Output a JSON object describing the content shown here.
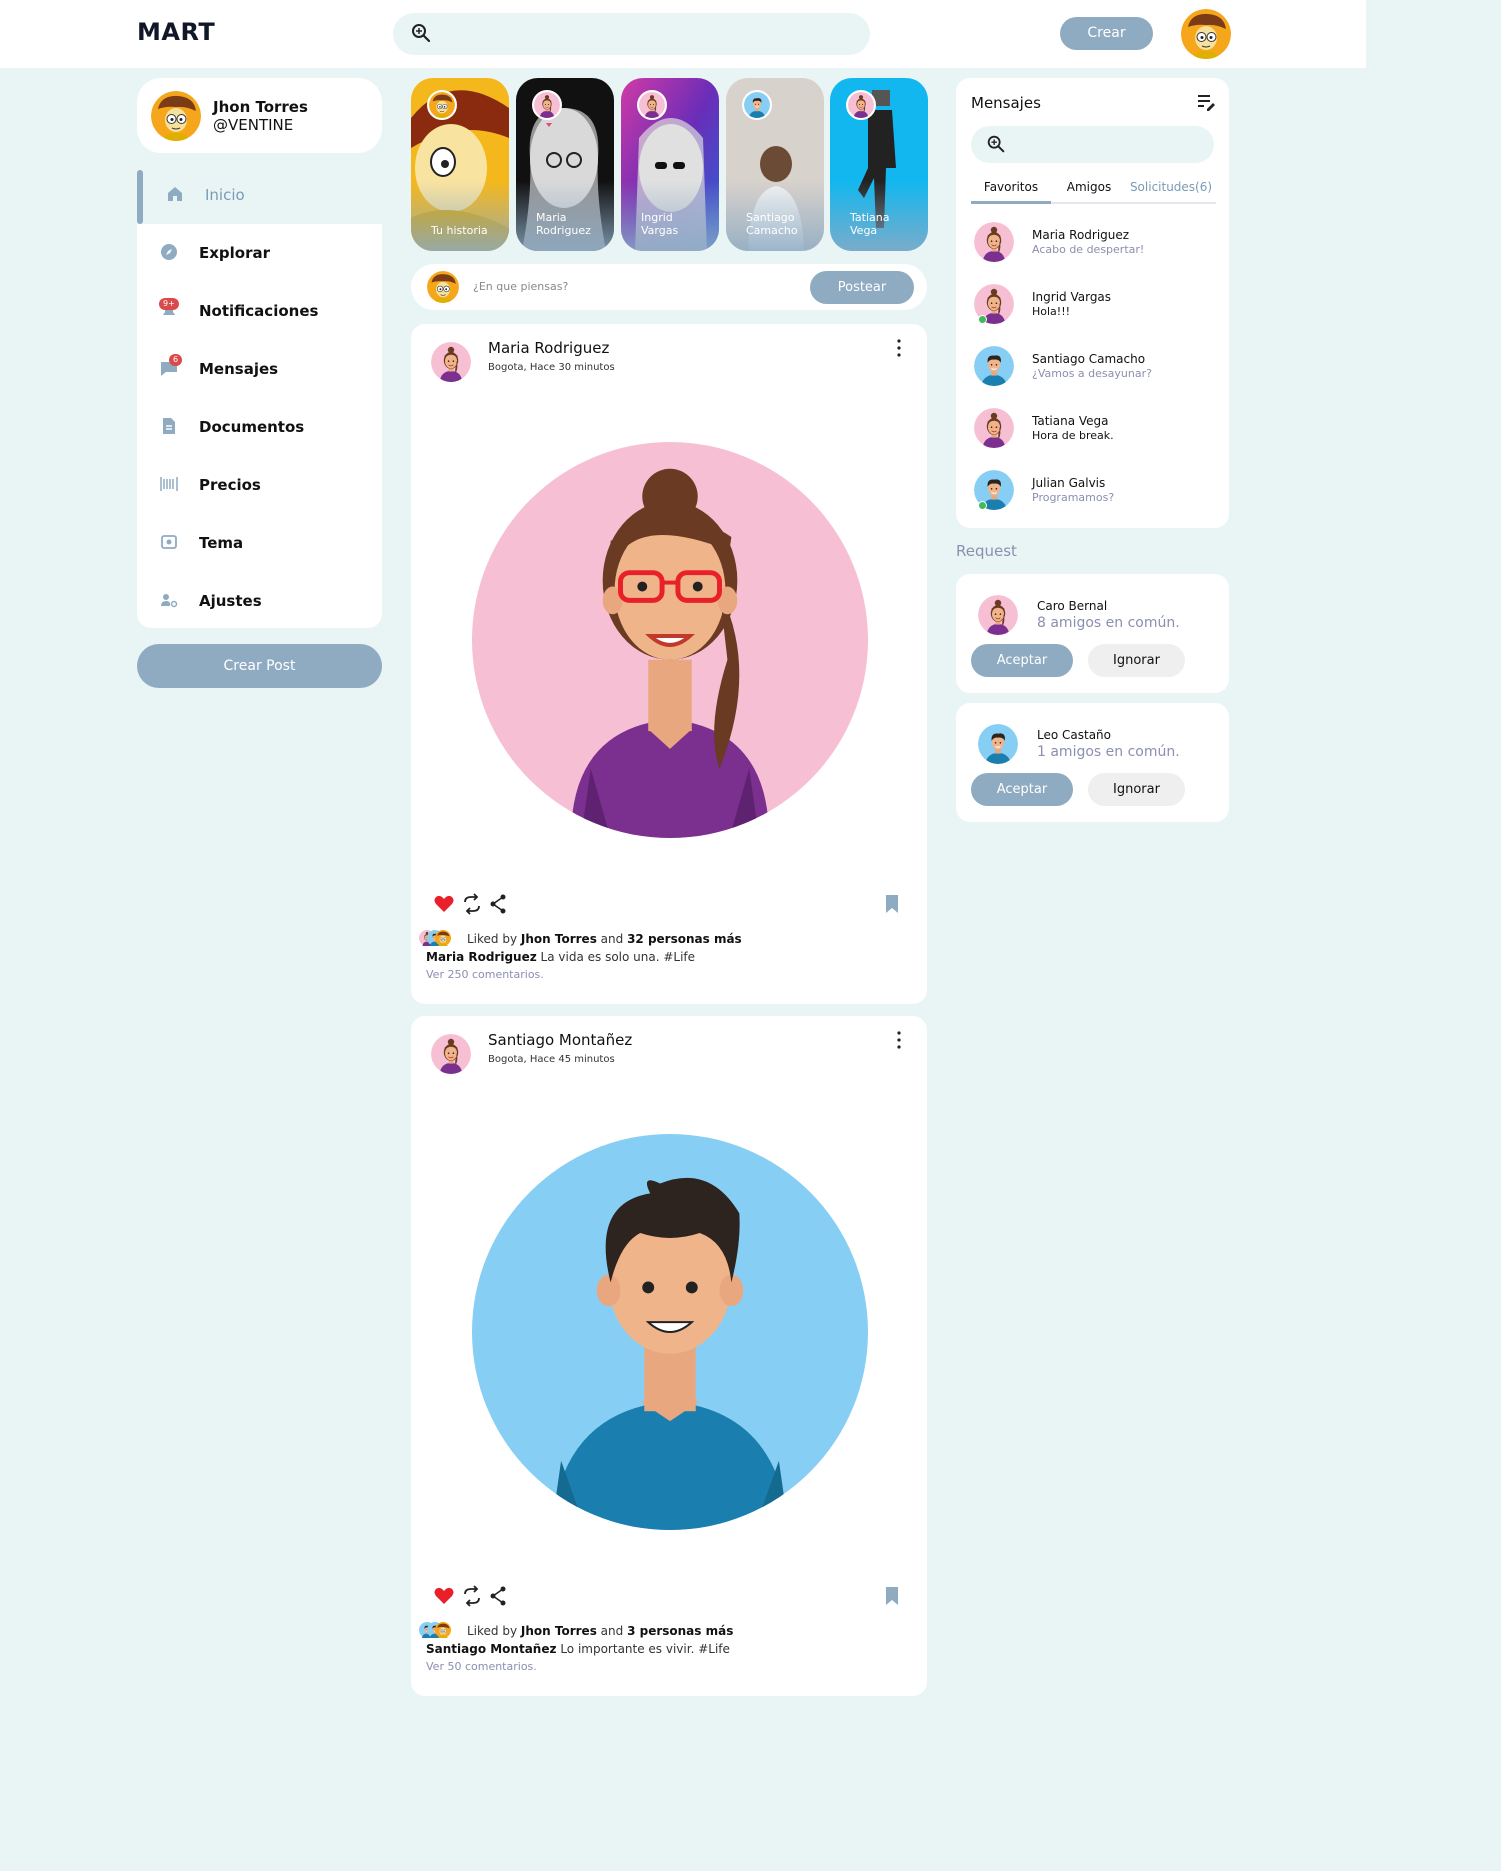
{
  "app": {
    "logo": "MART"
  },
  "header": {
    "search_placeholder": "",
    "create_label": "Crear"
  },
  "profile": {
    "name": "Jhon Torres",
    "handle": "@VENTINE"
  },
  "menu": {
    "items": [
      {
        "label": "Inicio",
        "icon": "home-icon"
      },
      {
        "label": "Explorar",
        "icon": "compass-icon"
      },
      {
        "label": "Notificaciones",
        "icon": "bell-icon",
        "badge": "9+"
      },
      {
        "label": "Mensajes",
        "icon": "chat-icon",
        "badge": "6"
      },
      {
        "label": "Documentos",
        "icon": "document-icon"
      },
      {
        "label": "Precios",
        "icon": "barcode-icon"
      },
      {
        "label": "Tema",
        "icon": "theme-icon"
      },
      {
        "label": "Ajustes",
        "icon": "settings-icon"
      }
    ],
    "create_post_label": "Crear Post"
  },
  "stories": [
    {
      "name_line1": "",
      "name_line2": "Tu historia"
    },
    {
      "name_line1": "Maria",
      "name_line2": "Rodriguez"
    },
    {
      "name_line1": "Ingrid",
      "name_line2": "Vargas"
    },
    {
      "name_line1": "Santiago",
      "name_line2": "Camacho"
    },
    {
      "name_line1": "Tatiana",
      "name_line2": "Vega"
    }
  ],
  "compose": {
    "placeholder": "¿En que piensas?",
    "button": "Postear"
  },
  "posts": [
    {
      "author": "Maria Rodriguez",
      "meta": "Bogota, Hace 30 minutos",
      "liked_prefix": "Liked by",
      "liked_user": "Jhon Torres",
      "liked_and": "and",
      "liked_rest": "32 personas más",
      "caption_author": "Maria Rodriguez",
      "caption_text": "La vida es solo una. #Life",
      "comments": "Ver 250 comentarios."
    },
    {
      "author": "Santiago Montañez",
      "meta": "Bogota, Hace 45 minutos",
      "liked_prefix": "Liked by",
      "liked_user": "Jhon Torres",
      "liked_and": "and",
      "liked_rest": "3 personas más",
      "caption_author": "Santiago Montañez",
      "caption_text": "Lo importante es vivir. #Life",
      "comments": "Ver 50 comentarios."
    }
  ],
  "messages": {
    "title": "Mensajes",
    "tabs": [
      "Favoritos",
      "Amigos",
      "Solicitudes(6)"
    ],
    "contacts": [
      {
        "name": "Maria Rodriguez",
        "message": "Acabo de despertar!",
        "avatar": "female"
      },
      {
        "name": "Ingrid Vargas",
        "message": "Hola!!!",
        "avatar": "female",
        "online": true
      },
      {
        "name": "Santiago Camacho",
        "message": "¿Vamos a desayunar?",
        "avatar": "male"
      },
      {
        "name": "Tatiana Vega",
        "message": "Hora de break.",
        "avatar": "female"
      },
      {
        "name": "Julian Galvis",
        "message": "Programamos?",
        "avatar": "male",
        "online": true
      }
    ]
  },
  "requests": {
    "title": "Request",
    "items": [
      {
        "name": "Caro Bernal",
        "mutual": "8 amigos en común.",
        "accept": "Aceptar",
        "ignore": "Ignorar",
        "avatar": "female"
      },
      {
        "name": "Leo Castaño",
        "mutual": "1 amigos en común.",
        "accept": "Aceptar",
        "ignore": "Ignorar",
        "avatar": "male"
      }
    ]
  },
  "colors": {
    "background": "#e9f5f5",
    "accent": "#8eabc2",
    "like": "#e8202a",
    "female_avatar_bg": "#f7bfd4",
    "male_avatar_bg": "#87cef4"
  }
}
